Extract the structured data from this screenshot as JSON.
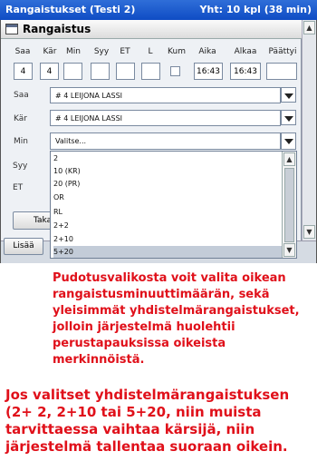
{
  "window": {
    "title": "Rangaistukset (Testi 2)",
    "summary": "Yht: 10 kpl (38 min)"
  },
  "dialog": {
    "title": "Rangaistus"
  },
  "columns": [
    "Saa",
    "Kär",
    "Min",
    "Syy",
    "ET",
    "L",
    "Kum",
    "Aika",
    "Alkaa",
    "Päättyi"
  ],
  "values": {
    "saa": "4",
    "kar": "4",
    "aika": "16:43",
    "alkaa": "16:43"
  },
  "fields": {
    "saa_label": "Saa",
    "saa_value": "# 4 LEIJONA LASSI",
    "kar_label": "Kär",
    "kar_value": "# 4 LEIJONA LASSI",
    "min_label": "Min",
    "min_value": "Valitse...",
    "syy_label": "Syy",
    "et_label": "ET"
  },
  "dropdown": {
    "options": [
      "2",
      "10 (KR)",
      "20 (PR)",
      "OR",
      "RL",
      "2+2",
      "2+10",
      "5+20"
    ],
    "selected_index": 7
  },
  "buttons": {
    "taka": "Taka",
    "lisaa": "Lisää"
  },
  "captions": {
    "first": "Pudotusvalikosta voit valita oikean rangaistusminuuttimäärän, sekä yleisimmät yhdistelmärangaistukset, jolloin järjestelmä huolehtii perustapauksissa oikeista merkinnöistä.",
    "second": "Jos valitset yhdistelmärangaistuksen (2+ 2, 2+10 tai 5+20, niin muista tarvittaessa vaihtaa kärsijä, niin järjestelmä tallentaa suoraan oikein."
  },
  "colors": {
    "titlebar": "#1a56cc",
    "caption": "#e0101a",
    "selected_row": "#c3ccd8"
  }
}
